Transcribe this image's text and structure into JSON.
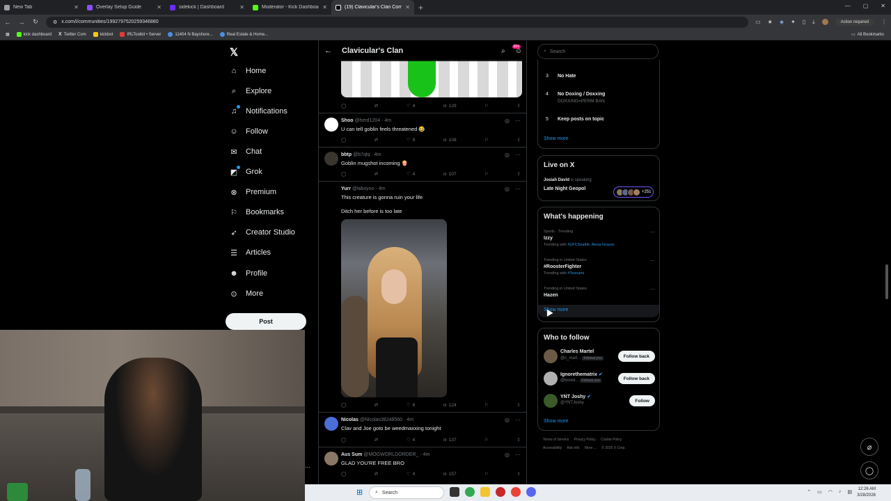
{
  "browser": {
    "tabs": [
      {
        "label": "New Tab",
        "color": "#9aa0a6",
        "active": false
      },
      {
        "label": "Overlay Setup Guide",
        "color": "#8a4fff",
        "active": false
      },
      {
        "label": "sidekick | Dashboard",
        "color": "#6a2cff",
        "active": false
      },
      {
        "label": "Moderator - Kick Dashboard",
        "color": "#53fc18",
        "active": false
      },
      {
        "label": "(19) Clavicular's Clan Commun",
        "color": "#ffffff",
        "active": true
      }
    ],
    "url": "x.com/i/communities/1992797520259346880",
    "action_required": "Action required",
    "bookmarks": [
      {
        "label": "kick dashboard",
        "color": "#53fc18"
      },
      {
        "label": "Twitter Com",
        "color": "#ffffff"
      },
      {
        "label": "kickbot",
        "color": "#f5c518"
      },
      {
        "label": "IRLToolkit • Server",
        "color": "#e53935"
      },
      {
        "label": "11404 N Bayshore...",
        "color": "#4a90e2"
      },
      {
        "label": "Real Estate & Home...",
        "color": "#4a90e2"
      }
    ],
    "all_bookmarks": "All Bookmarks"
  },
  "nav": {
    "items": [
      {
        "label": "Home",
        "icon": "home-icon",
        "glyph": "⌂"
      },
      {
        "label": "Explore",
        "icon": "search-icon",
        "glyph": "⌕"
      },
      {
        "label": "Notifications",
        "icon": "bell-icon",
        "glyph": "♫"
      },
      {
        "label": "Follow",
        "icon": "person-plus-icon",
        "glyph": "☺"
      },
      {
        "label": "Chat",
        "icon": "mail-icon",
        "glyph": "✉"
      },
      {
        "label": "Grok",
        "icon": "grok-icon",
        "glyph": "◩"
      },
      {
        "label": "Premium",
        "icon": "x-circle-icon",
        "glyph": "⊗"
      },
      {
        "label": "Bookmarks",
        "icon": "bookmark-icon",
        "glyph": "⚐"
      },
      {
        "label": "Creator Studio",
        "icon": "rocket-icon",
        "glyph": "➶"
      },
      {
        "label": "Articles",
        "icon": "article-icon",
        "glyph": "☰"
      },
      {
        "label": "Profile",
        "icon": "profile-icon",
        "glyph": "☻"
      },
      {
        "label": "More",
        "icon": "more-icon",
        "glyph": "⊙"
      }
    ],
    "post_label": "Post"
  },
  "community": {
    "title": "Clavicular's Clan",
    "badge": "20+"
  },
  "posts": [
    {
      "name": "Shoo",
      "handle": "@herd1204",
      "time": "4m",
      "text": "U can tell goblin feels threatened 😂",
      "likes": "8",
      "views": "108",
      "avatar_color": "#ffffff"
    },
    {
      "name": "bbtp",
      "handle": "@b7qlq",
      "time": "4m",
      "text": "Goblin mugshot incoming 🍿",
      "likes": "4",
      "views": "107",
      "avatar_color": "#3b3530"
    },
    {
      "name": "Yurr",
      "handle": "@laboyoo",
      "time": "4m",
      "text": "This creature is gonna ruin your life",
      "text2": "Ditch her before is too late",
      "likes": "8",
      "views": "124",
      "avatar_color": "#000000"
    },
    {
      "name": "Nicolas",
      "handle": "@Nicolas38248560",
      "time": "4m",
      "text": "Clav and Joe goto be weedmaxxing tonight",
      "likes": "4",
      "views": "137",
      "avatar_color": "#4a6fd8"
    },
    {
      "name": "Aus Sum",
      "handle": "@MOGWORLDORDER_",
      "time": "4m",
      "text": "GLAD YOU'RE FREE BRO",
      "likes": "4",
      "views": "157",
      "avatar_color": "#8a7766"
    }
  ],
  "top_post": {
    "likes": "4",
    "views": "129"
  },
  "sidebar": {
    "search_placeholder": "Search",
    "rules": [
      {
        "num": "3",
        "title": "No Hate",
        "sub": ""
      },
      {
        "num": "4",
        "title": "No Doxing / Doxxing",
        "sub": "DOXXING=PERM BAN"
      },
      {
        "num": "5",
        "title": "Keep posts on topic",
        "sub": ""
      }
    ],
    "show_more": "Show more",
    "live": {
      "title": "Live on X",
      "speaker": "Josiah David",
      "speaking": "is speaking",
      "space_title": "Late Night Geopol",
      "count": "+251"
    },
    "happening": {
      "title": "What's happening",
      "trends": [
        {
          "meta": "Sports · Trending",
          "name": "Izzy",
          "with_prefix": "Trending with",
          "with": "#UFCSeattle, Alexa Grasso"
        },
        {
          "meta": "Trending in United States",
          "name": "#RoosterFighter",
          "with_prefix": "Trending with",
          "with": "#Toonami"
        },
        {
          "meta": "Trending in United States",
          "name": "Hazen",
          "with_prefix": "",
          "with": ""
        }
      ]
    },
    "who_to_follow": {
      "title": "Who to follow",
      "accounts": [
        {
          "name": "Charles Martel",
          "handle": "@c_mart...",
          "follows_you": "Follows you",
          "button": "Follow back",
          "verified": false,
          "avatar_color": "#6b5a44"
        },
        {
          "name": "Ignorethematrix",
          "handle": "@bored...",
          "follows_you": "Follows you",
          "button": "Follow back",
          "verified": true,
          "avatar_color": "#b0b0b0"
        },
        {
          "name": "YNT Joshy",
          "handle": "@YNTJoshy",
          "follows_you": "",
          "button": "Follow",
          "verified": true,
          "avatar_color": "#3a5a2a"
        }
      ]
    },
    "footer": [
      "Terms of Service",
      "Privacy Policy",
      "Cookie Policy",
      "Accessibility",
      "Ads info",
      "More ...",
      "© 2026 X Corp."
    ]
  },
  "taskbar": {
    "search": "Search",
    "time": "12:26 AM",
    "date": "3/28/2026"
  },
  "colors": {
    "accent": "#1d9bf0",
    "background": "#000000",
    "border": "#2f3336"
  }
}
